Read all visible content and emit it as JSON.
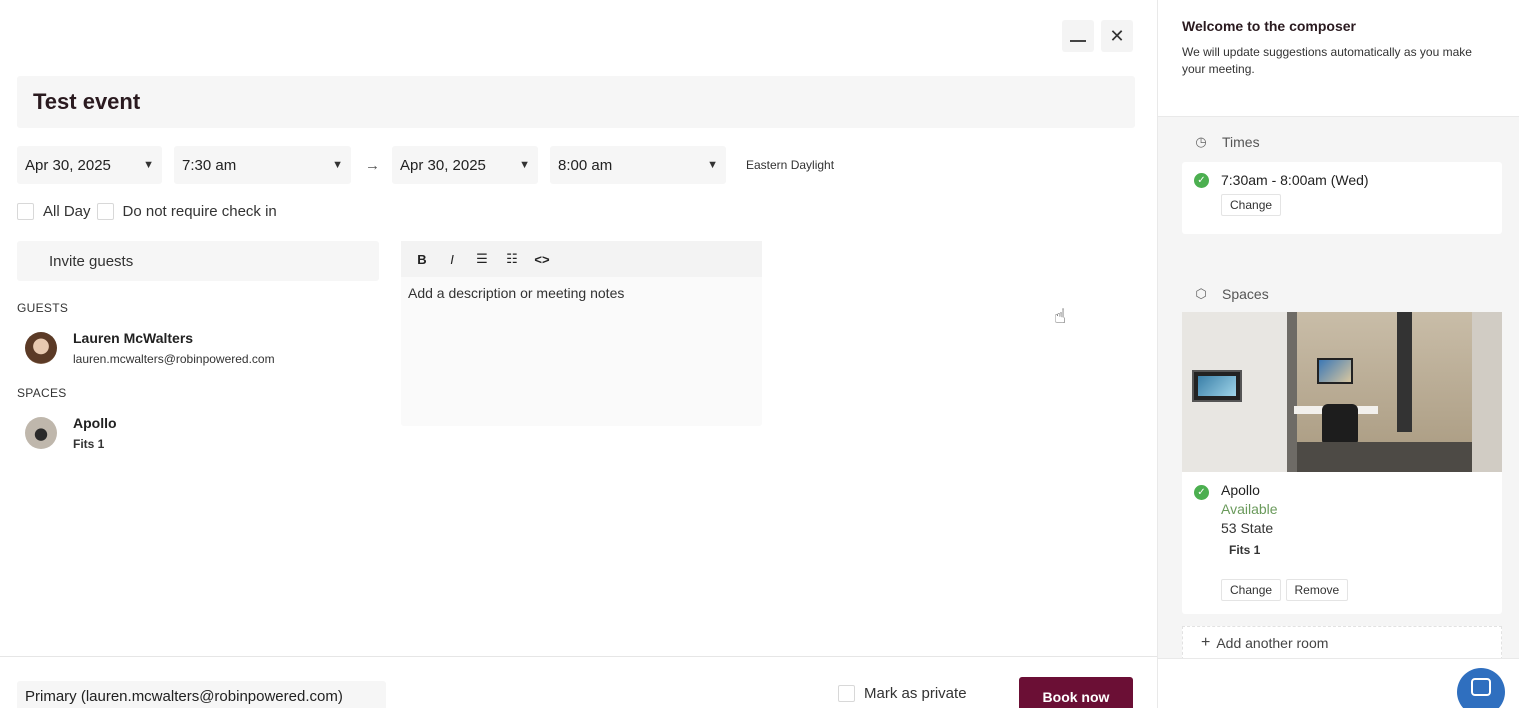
{
  "event": {
    "title": "Test event",
    "start_date": "Apr 30, 2025",
    "start_time": "7:30 am",
    "end_date": "Apr 30, 2025",
    "end_time": "8:00 am",
    "arrow": "→",
    "timezone": "Eastern Daylight",
    "all_day_label": "All Day",
    "no_checkin_label": "Do not require check in"
  },
  "guests": {
    "invite_placeholder": "Invite guests",
    "section_label": "GUESTS",
    "items": [
      {
        "name": "Lauren McWalters",
        "email": "lauren.mcwalters@robinpowered.com"
      }
    ]
  },
  "spaces": {
    "section_label": "SPACES",
    "items": [
      {
        "name": "Apollo",
        "capacity": "Fits 1"
      }
    ]
  },
  "editor": {
    "bold": "B",
    "italic": "I",
    "bullet_list": "☰",
    "ordered_list": "☷",
    "code": "<>",
    "placeholder": "Add a description or meeting notes"
  },
  "footer": {
    "calendar": "Primary (lauren.mcwalters@robinpowered.com)",
    "private_label": "Mark as private",
    "book_label": "Book now"
  },
  "side": {
    "welcome_title": "Welcome to the composer",
    "welcome_text": "We will update suggestions automatically as you make your meeting.",
    "times_label": "Times",
    "time_value": "7:30am - 8:00am (Wed)",
    "change_label": "Change",
    "spaces_label": "Spaces",
    "room_name": "Apollo",
    "room_status": "Available",
    "room_location": "53 State",
    "room_capacity": "Fits 1",
    "remove_label": "Remove",
    "add_room_label": "Add another room"
  },
  "colors": {
    "primary": "#6b0f35",
    "available": "#4caf50",
    "chat": "#2f6fbf"
  }
}
